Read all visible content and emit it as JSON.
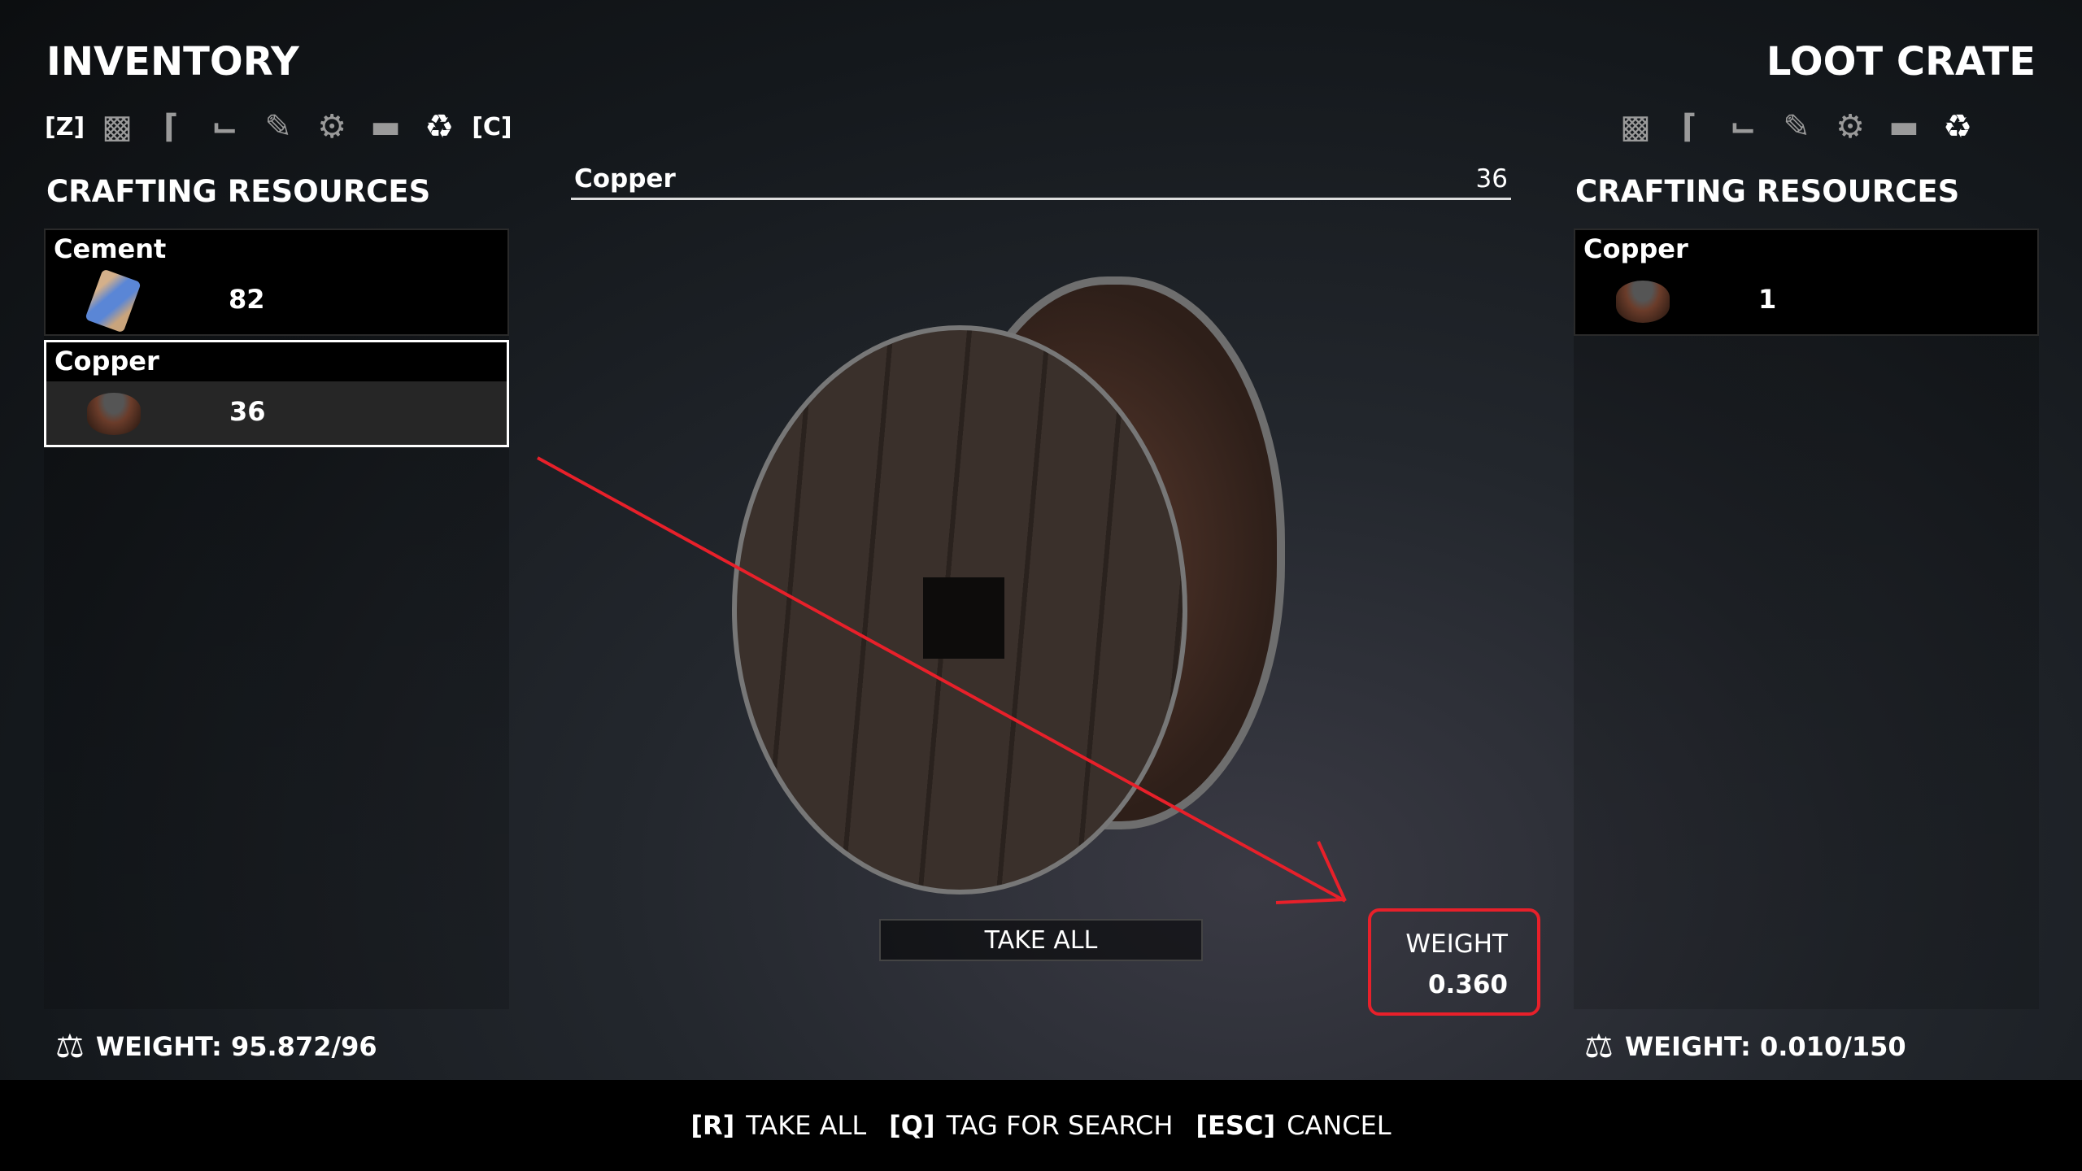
{
  "inventory": {
    "title": "INVENTORY",
    "key_left": "[Z]",
    "key_right": "[C]",
    "category_icons": [
      "backpack-icon",
      "rifle-icon",
      "pistol-icon",
      "ammo-icon",
      "gear-icon",
      "launcher-icon",
      "recycle-icon"
    ],
    "active_category": "recycle-icon",
    "section": "CRAFTING RESOURCES",
    "items": [
      {
        "name": "Cement",
        "qty": "82"
      },
      {
        "name": "Copper",
        "qty": "36",
        "selected": true
      }
    ],
    "weight": "WEIGHT: 95.872/96"
  },
  "loot": {
    "title": "LOOT CRATE",
    "category_icons": [
      "backpack-icon",
      "rifle-icon",
      "pistol-icon",
      "ammo-icon",
      "gear-icon",
      "launcher-icon",
      "recycle-icon"
    ],
    "section": "CRAFTING RESOURCES",
    "items": [
      {
        "name": "Copper",
        "qty": "1"
      }
    ],
    "weight": "WEIGHT: 0.010/150"
  },
  "detail": {
    "name": "Copper",
    "qty": "36",
    "take_all": "TAKE ALL",
    "weight_label": "WEIGHT",
    "weight_value": "0.360"
  },
  "footer": [
    {
      "key": "[R]",
      "label": "TAKE ALL"
    },
    {
      "key": "[Q]",
      "label": "TAG FOR SEARCH"
    },
    {
      "key": "[ESC]",
      "label": "CANCEL"
    }
  ],
  "colors": {
    "annotation": "#e8202a",
    "selected_border": "#ffffff"
  }
}
